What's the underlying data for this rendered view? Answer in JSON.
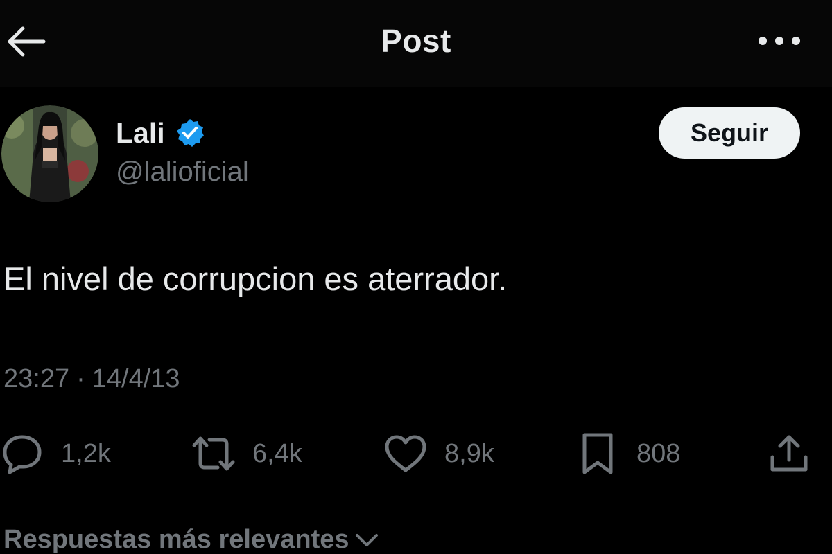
{
  "header": {
    "title": "Post"
  },
  "author": {
    "name": "Lali",
    "handle": "@lalioficial",
    "verified": true,
    "follow_label": "Seguir"
  },
  "tweet": {
    "text": "El nivel de corrupcion es aterrador.",
    "time": "23:27",
    "separator": "·",
    "date": "14/4/13"
  },
  "actions": {
    "replies": "1,2k",
    "reposts": "6,4k",
    "likes": "8,9k",
    "bookmarks": "808"
  },
  "replies_sort": {
    "label": "Respuestas más relevantes"
  },
  "icons": {
    "back": "arrow-left-icon",
    "more": "more-horizontal-icon",
    "verified": "verified-badge-icon",
    "reply": "speech-bubble-icon",
    "repost": "repost-arrows-icon",
    "like": "heart-icon",
    "bookmark": "bookmark-icon",
    "share": "share-upload-icon",
    "sort": "chevron-down-icon"
  },
  "colors": {
    "background": "#000000",
    "text": "#e7e9ea",
    "muted": "#71767b",
    "verified_blue": "#1d9bf0",
    "follow_bg": "#eff3f4"
  }
}
